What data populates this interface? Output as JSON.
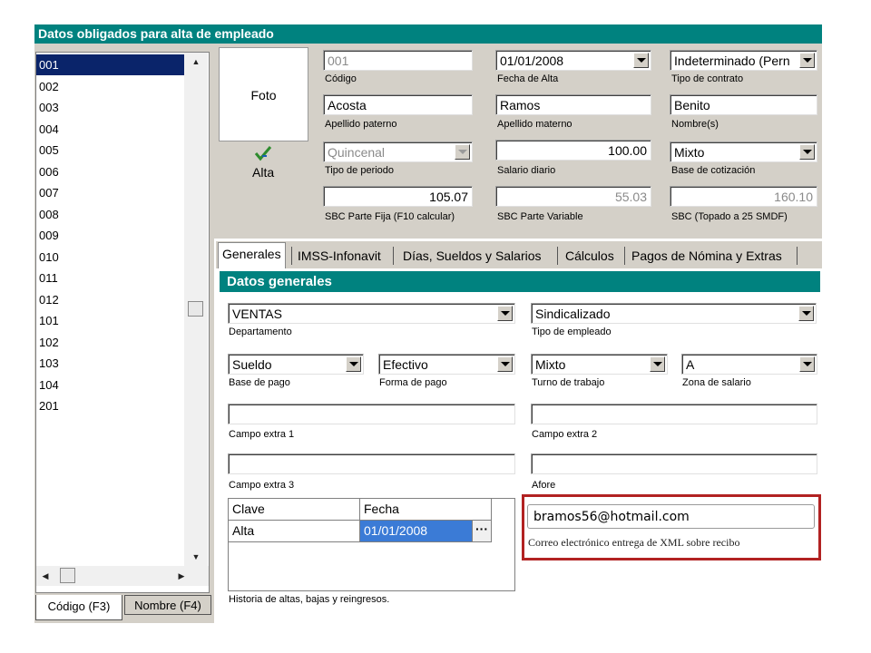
{
  "window": {
    "title": "Datos obligados para alta de empleado"
  },
  "employee_list": {
    "items": [
      "001",
      "002",
      "003",
      "004",
      "005",
      "006",
      "007",
      "008",
      "009",
      "010",
      "011",
      "012",
      "101",
      "102",
      "103",
      "104",
      "201"
    ],
    "selected": "001",
    "tabs": [
      "Código (F3)",
      "Nombre (F4)"
    ]
  },
  "header": {
    "foto_label": "Foto",
    "alta_label": "Alta",
    "codigo": {
      "value": "001",
      "label": "Código"
    },
    "fecha_alta": {
      "value": "01/01/2008",
      "label": "Fecha de Alta"
    },
    "tipo_contrato": {
      "value": "Indeterminado (Pern",
      "label": "Tipo de contrato"
    },
    "apellido_paterno": {
      "value": "Acosta",
      "label": "Apellido paterno"
    },
    "apellido_materno": {
      "value": "Ramos",
      "label": "Apellido materno"
    },
    "nombres": {
      "value": "Benito",
      "label": "Nombre(s)"
    },
    "tipo_periodo": {
      "value": "Quincenal",
      "label": "Tipo de periodo"
    },
    "salario_diario": {
      "value": "100.00",
      "label": "Salario diario"
    },
    "base_cotizacion": {
      "value": "Mixto",
      "label": "Base de cotización"
    },
    "sbc_fija": {
      "value": "105.07",
      "label": "SBC Parte Fija  (F10 calcular)"
    },
    "sbc_variable": {
      "value": "55.03",
      "label": "SBC Parte Variable"
    },
    "sbc_topado": {
      "value": "160.10",
      "label": "SBC (Topado a 25 SMDF)"
    }
  },
  "tabs": [
    "Generales",
    "IMSS-Infonavit",
    "Días, Sueldos y Salarios",
    "Cálculos",
    "Pagos de Nómina y Extras"
  ],
  "datos_generales": {
    "title": "Datos generales",
    "departamento": {
      "value": "VENTAS",
      "label": "Departamento"
    },
    "tipo_empleado": {
      "value": "Sindicalizado",
      "label": "Tipo de empleado"
    },
    "base_pago": {
      "value": "Sueldo",
      "label": "Base de pago"
    },
    "forma_pago": {
      "value": "Efectivo",
      "label": "Forma de pago"
    },
    "turno_trabajo": {
      "value": "Mixto",
      "label": "Turno de trabajo"
    },
    "zona_salario": {
      "value": "A",
      "label": "Zona de salario"
    },
    "campo_extra_1": {
      "value": "",
      "label": "Campo extra 1"
    },
    "campo_extra_2": {
      "value": "",
      "label": "Campo extra 2"
    },
    "campo_extra_3": {
      "value": "",
      "label": "Campo extra 3"
    },
    "afore": {
      "value": "",
      "label": "Afore"
    },
    "historia": {
      "columns": [
        "Clave",
        "Fecha"
      ],
      "rows": [
        {
          "clave": "Alta",
          "fecha": "01/01/2008"
        }
      ],
      "label": "Historia de altas, bajas y reingresos."
    },
    "correo": {
      "value": "bramos56@hotmail.com",
      "label": "Correo electrónico entrega de XML sobre recibo"
    }
  },
  "colors": {
    "title_bar": "#00827f",
    "selection": "#0a246a",
    "highlight_frame": "#b22222"
  }
}
